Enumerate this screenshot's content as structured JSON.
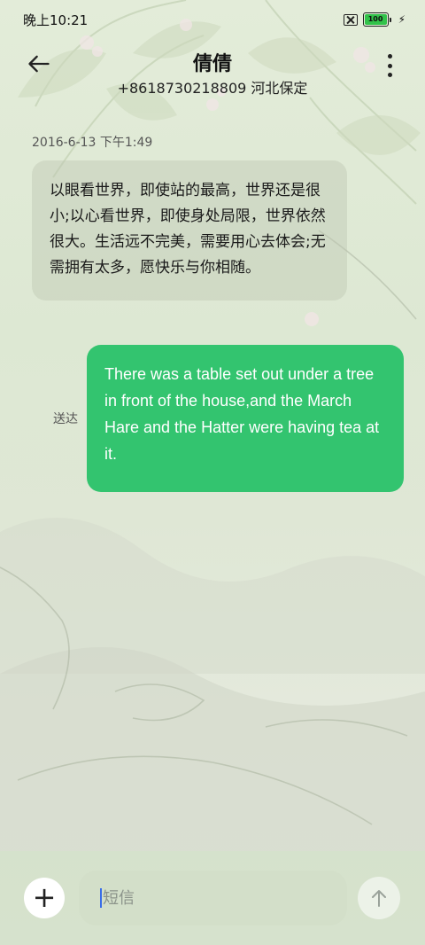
{
  "status_bar": {
    "time": "晚上10:21",
    "battery_level": "100",
    "icons": [
      "sim-off-icon",
      "battery-icon",
      "charging-bolt-icon"
    ]
  },
  "header": {
    "back_icon": "back-arrow-icon",
    "contact_name": "倩倩",
    "contact_detail": "+8618730218809 河北保定",
    "more_icon": "more-vertical-icon"
  },
  "conversation": {
    "timestamp": "2016-6-13 下午1:49",
    "incoming_message": "以眼看世界，即使站的最高，世界还是很小;以心看世界，即使身处局限，世界依然很大。生活远不完美，需要用心去体会;无需拥有太多，愿快乐与你相随。",
    "outgoing_message": "There was a table set out under a tree in front of the house,and the March Hare and the Hatter were having tea at it.",
    "outgoing_status": "送达"
  },
  "compose": {
    "add_icon": "plus-icon",
    "placeholder": "短信",
    "value": "",
    "send_icon": "send-arrow-up-icon"
  },
  "colors": {
    "outgoing_bubble": "#33c46f",
    "incoming_bubble": "#c6cfbd",
    "battery": "#32c24a",
    "caret": "#3a6ee8"
  }
}
